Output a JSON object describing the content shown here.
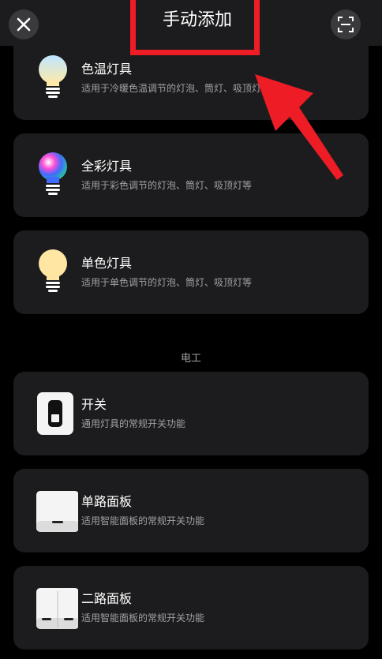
{
  "header": {
    "title": "手动添加",
    "close_icon": "close-icon",
    "scan_icon": "scan-icon"
  },
  "lights": [
    {
      "name": "色温灯具",
      "desc": "适用于冷暖色温调节的灯泡、筒灯、吸顶灯等",
      "icon": "bulb-color-temperature-icon"
    },
    {
      "name": "全彩灯具",
      "desc": "适用于彩色调节的灯泡、筒灯、吸顶灯等",
      "icon": "bulb-rgb-icon"
    },
    {
      "name": "单色灯具",
      "desc": "适用于单色调节的灯泡、筒灯、吸顶灯等",
      "icon": "bulb-single-color-icon"
    }
  ],
  "section": {
    "electric_label": "电工"
  },
  "electric": [
    {
      "name": "开关",
      "desc": "通用灯具的常规开关功能",
      "icon": "switch-icon"
    },
    {
      "name": "单路面板",
      "desc": "适用智能面板的常规开关功能",
      "icon": "single-panel-icon"
    },
    {
      "name": "二路面板",
      "desc": "适用智能面板的常规开关功能",
      "icon": "double-panel-icon"
    }
  ],
  "colors": {
    "background": "#000000",
    "card": "#1c1c1e",
    "annotation_red": "#ee1c25",
    "secondary_text": "#a1a1a6"
  }
}
